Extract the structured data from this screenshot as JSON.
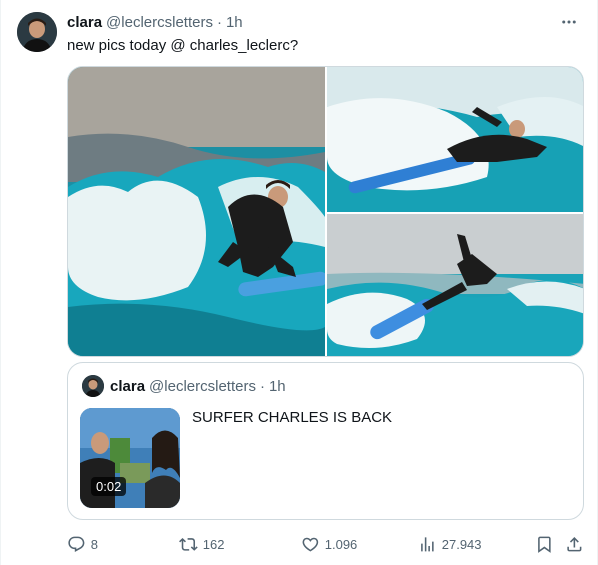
{
  "post": {
    "author_name": "clara",
    "author_handle": "@leclercsletters",
    "separator": "·",
    "time": "1h",
    "text": "new pics today @ charles_leclerc?",
    "more_icon": "more-horizontal-icon"
  },
  "media": [
    {
      "alt": "surfer-photo-1"
    },
    {
      "alt": "surfer-photo-2"
    },
    {
      "alt": "surfer-photo-3"
    }
  ],
  "quoted": {
    "author_name": "clara",
    "author_handle": "@leclercsletters",
    "separator": "·",
    "time": "1h",
    "text": "SURFER CHARLES IS BACK",
    "video_duration": "0:02"
  },
  "actions": {
    "replies": "8",
    "reposts": "162",
    "likes": "1.096",
    "views": "27.943"
  },
  "colors": {
    "text_primary": "#0f1419",
    "text_secondary": "#536471",
    "border": "#cfd9de",
    "wave": "#1aa3b8"
  }
}
